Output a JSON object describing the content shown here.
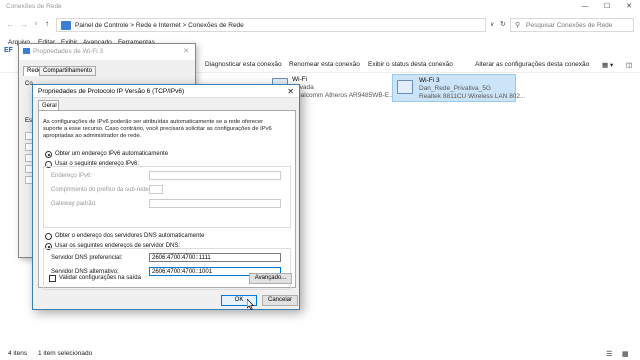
{
  "explorer": {
    "title": "Conexões de Rede",
    "breadcrumb": [
      "Painel de Controle",
      ">",
      "Rede e Internet",
      ">",
      "Conexões de Rede"
    ],
    "search_placeholder": "Pesquisar Conexões de Rede",
    "menu": [
      "Arquivo",
      "Editar",
      "Exibir",
      "Avançado",
      "Ferramentas"
    ],
    "left_label": "EF",
    "commands": [
      "Diagnosticar esta conexão",
      "Renomear esta conexão",
      "Exibir o status desta conexão",
      "Alterar as configurações desta conexão"
    ],
    "connections": [
      {
        "name": "Wi-Fi",
        "status": "Ativada",
        "adapter": "Qualcomm Atheros AR9485WB-E..."
      },
      {
        "name": "Wi-Fi 3",
        "status": "Dan_Rede_Privativa_5G",
        "adapter": "Realtek 8811CU Wireless LAN 802..."
      }
    ],
    "status": {
      "items": "4 itens",
      "selected": "1 item selecionado"
    }
  },
  "wifi_dialog": {
    "title": "Propriedades de Wi-Fi 3",
    "tabs": [
      "Rede",
      "Compartilhamento"
    ],
    "stub_labels": [
      "Co",
      "Es"
    ]
  },
  "ipv6_dialog": {
    "title": "Propriedades de Protocolo IP Versão 6 (TCP/IPv6)",
    "tab": "Geral",
    "description": "As configurações de IPv6 poderão ser atribuídas automaticamente se a rede oferecer suporte a esse recurso. Caso contrário, você precisará solicitar as configurações de IPv6 apropriadas ao administrador de rede.",
    "auto_ip": "Obter um endereço IPv6 automaticamente",
    "manual_ip": "Usar o seguinte endereço IPv6:",
    "ip_label": "Endereço IPv6:",
    "prefix_label": "Comprimento do prefixo da sub-rede:",
    "gateway_label": "Gateway padrão:",
    "auto_dns": "Obter o endereço dos servidores DNS automaticamente",
    "manual_dns": "Usar os seguintes endereços de servidor DNS:",
    "dns1_label": "Servidor DNS preferencial:",
    "dns1_value": "2606:4700:4700::1111",
    "dns2_label": "Servidor DNS alternativo:",
    "dns2_value": "2606:4700:4700::1001",
    "validate_label": "Validar configurações na saída",
    "advanced_button": "Avançado...",
    "ok_button": "OK",
    "cancel_button": "Cancelar"
  }
}
